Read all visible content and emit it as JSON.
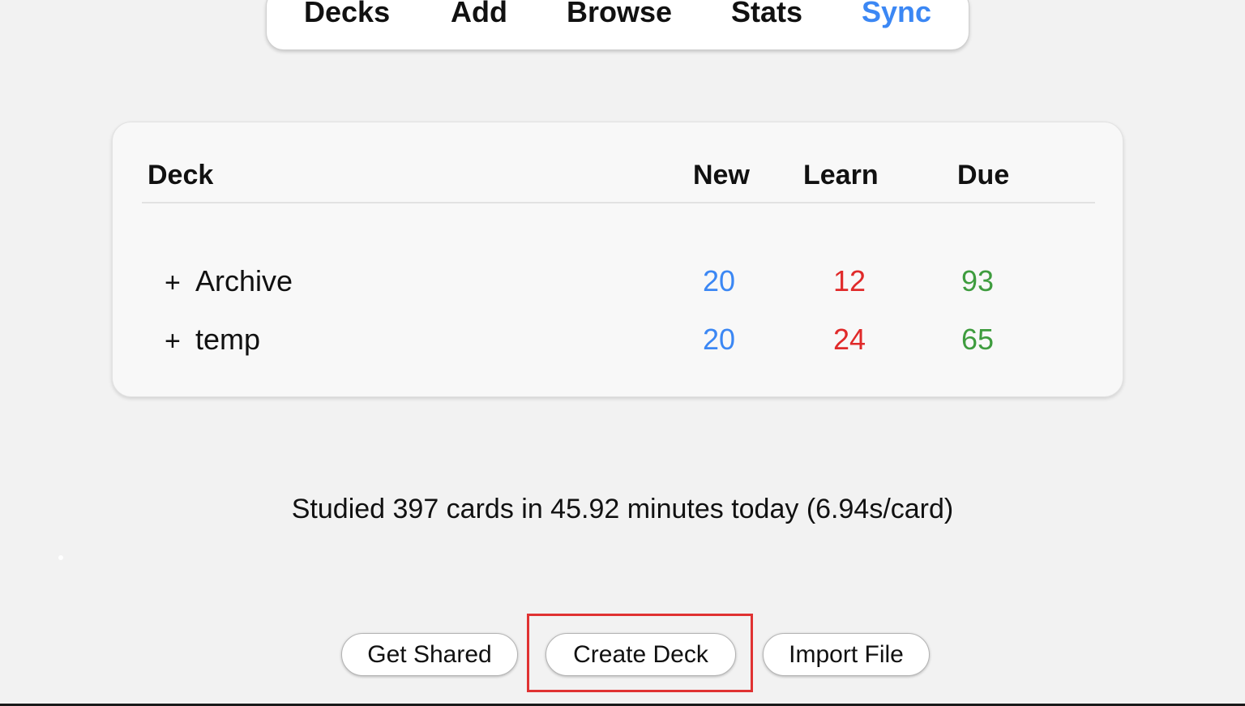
{
  "toolbar": {
    "items": [
      {
        "label": "Decks",
        "active": false
      },
      {
        "label": "Add",
        "active": false
      },
      {
        "label": "Browse",
        "active": false
      },
      {
        "label": "Stats",
        "active": false
      },
      {
        "label": "Sync",
        "active": true
      }
    ]
  },
  "deck_table": {
    "headers": {
      "deck": "Deck",
      "new": "New",
      "learn": "Learn",
      "due": "Due"
    },
    "rows": [
      {
        "expander": "+",
        "name": "Archive",
        "new": "20",
        "learn": "12",
        "due": "93"
      },
      {
        "expander": "+",
        "name": "temp",
        "new": "20",
        "learn": "24",
        "due": "65"
      }
    ]
  },
  "summary": {
    "text": "Studied 397 cards in 45.92 minutes today (6.94s/card)"
  },
  "buttons": {
    "get_shared": "Get Shared",
    "create_deck": "Create Deck",
    "import_file": "Import File"
  },
  "highlight": {
    "target": "create-deck-button",
    "color": "#e03232"
  },
  "colors": {
    "accent": "#3b87f4",
    "new": "#3b87f4",
    "learn": "#e02a2a",
    "due": "#3e9c3e"
  }
}
